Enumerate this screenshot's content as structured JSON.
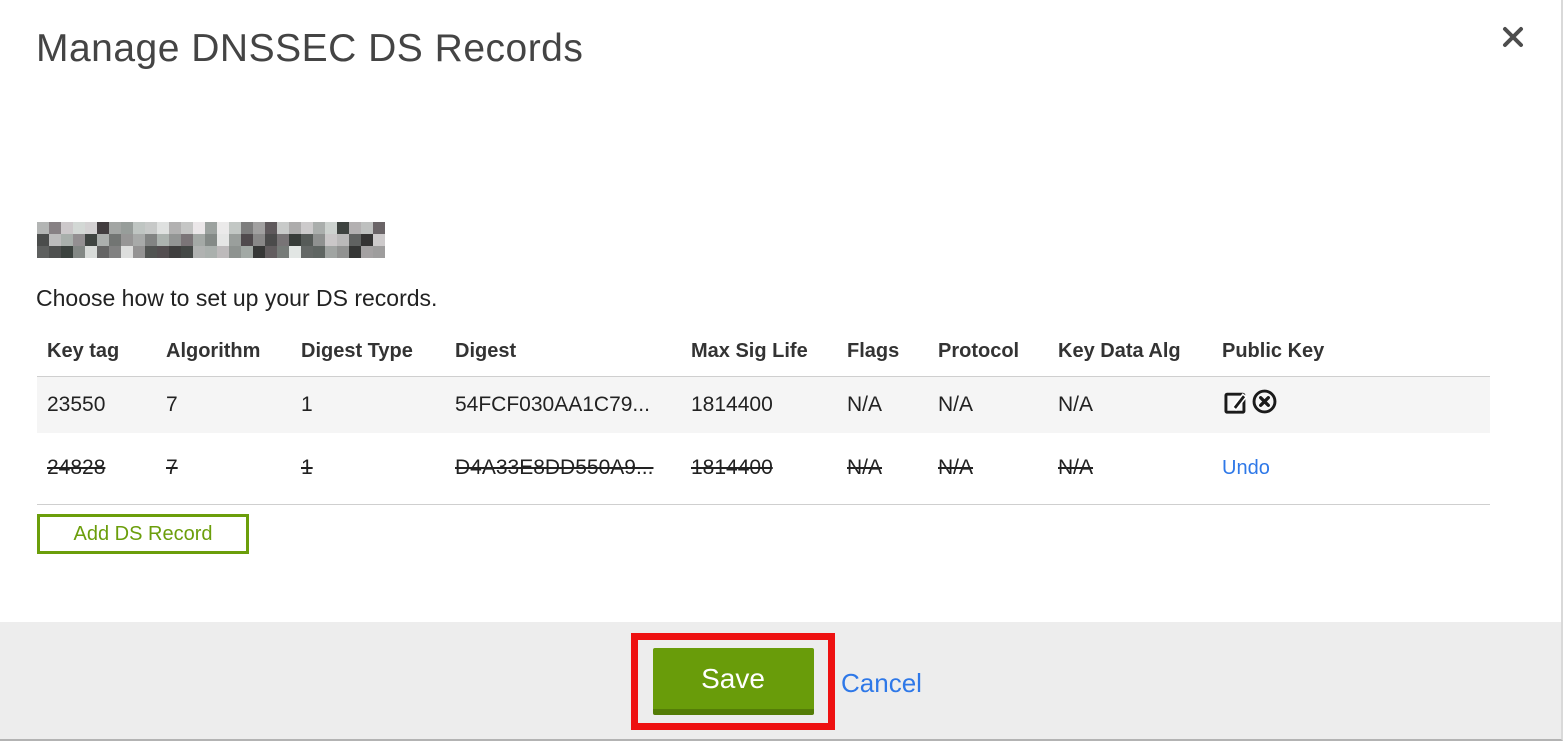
{
  "modal": {
    "title": "Manage DNSSEC DS Records",
    "subtitle": "Choose how to set up your DS records.",
    "close_icon": "close-x-icon"
  },
  "table": {
    "columns": [
      "Key tag",
      "Algorithm",
      "Digest Type",
      "Digest",
      "Max Sig Life",
      "Flags",
      "Protocol",
      "Key Data Alg",
      "Public Key"
    ],
    "rows": [
      {
        "key_tag": "23550",
        "algorithm": "7",
        "digest_type": "1",
        "digest": "54FCF030AA1C79...",
        "max_sig_life": "1814400",
        "flags": "N/A",
        "protocol": "N/A",
        "key_data_alg": "N/A",
        "public_key": "",
        "state": "current",
        "actions": [
          "edit-icon",
          "delete-circle-x-icon"
        ]
      },
      {
        "key_tag": "24828",
        "algorithm": "7",
        "digest_type": "1",
        "digest": "D4A33E8DD550A9...",
        "max_sig_life": "1814400",
        "flags": "N/A",
        "protocol": "N/A",
        "key_data_alg": "N/A",
        "public_key": "",
        "state": "deleted",
        "action_label": "Undo"
      }
    ]
  },
  "buttons": {
    "add_ds_record": "Add DS Record",
    "save": "Save",
    "cancel": "Cancel"
  },
  "colors": {
    "green": "#699c0a",
    "green_dark": "#547d07",
    "link_blue": "#2e78e8",
    "annotation_red": "#ee1111",
    "row_gray": "#f5f5f5",
    "footer_gray": "#ededed"
  }
}
